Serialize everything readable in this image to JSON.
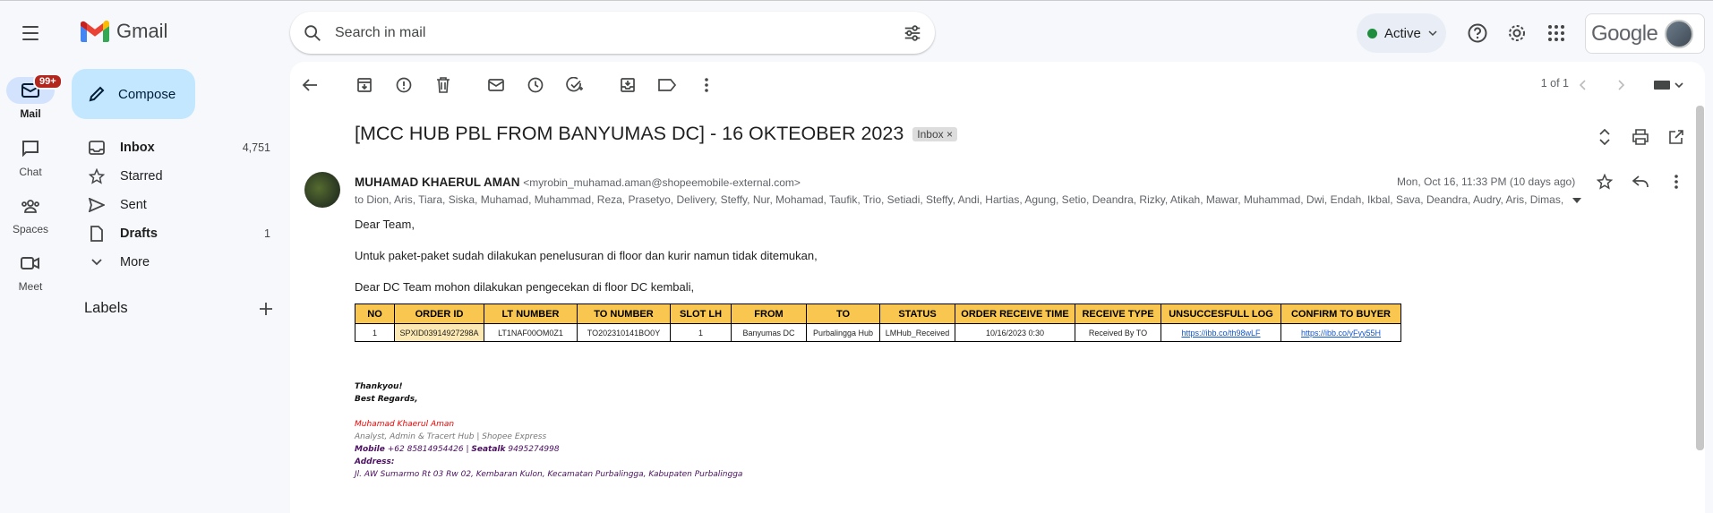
{
  "app": {
    "name": "Gmail"
  },
  "search": {
    "placeholder": "Search in mail"
  },
  "header": {
    "status": "Active",
    "account_brand": "Google"
  },
  "rail": {
    "mail_label": "Mail",
    "mail_badge": "99+",
    "chat_label": "Chat",
    "spaces_label": "Spaces",
    "meet_label": "Meet"
  },
  "nav": {
    "compose": "Compose",
    "items": [
      {
        "label": "Inbox",
        "count": "4,751",
        "icon": "inbox-icon"
      },
      {
        "label": "Starred",
        "count": "",
        "icon": "star-icon"
      },
      {
        "label": "Sent",
        "count": "",
        "icon": "send-icon"
      },
      {
        "label": "Drafts",
        "count": "1",
        "icon": "draft-icon"
      },
      {
        "label": "More",
        "count": "",
        "icon": "chevron-down-icon"
      }
    ],
    "labels_title": "Labels"
  },
  "toolbar": {
    "pager": "1 of 1"
  },
  "email": {
    "subject": "[MCC HUB PBL FROM BANYUMAS DC] - 16 OKTEOBER 2023",
    "tag": "Inbox",
    "sender_name": "MUHAMAD KHAERUL AMAN",
    "sender_email": "<myrobin_muhamad.aman@shopeemobile-external.com>",
    "to": "to Dion, Aris, Tiara, Siska, Muhamad, Muhammad, Reza, Prasetyo, Delivery, Steffy, Nur, Mohamad, Taufik, Trio, Setiadi, Steffy, Andi, Hartias, Agung, Setio, Deandra, Rizky, Atikah, Mawar, Muhammad, Dwi, Endah, Ikbal, Sava, Deandra, Audry, Aris, Dimas,",
    "date": "Mon, Oct 16, 11:33 PM (10 days ago)",
    "greeting": "Dear Team,",
    "line1": "Untuk paket-paket sudah dilakukan penelusuran di floor dan kurir namun tidak ditemukan,",
    "line2": "Dear DC Team mohon dilakukan pengecekan di floor DC kembali,",
    "table": {
      "headers": [
        "NO",
        "ORDER ID",
        "LT NUMBER",
        "TO NUMBER",
        "SLOT LH",
        "FROM",
        "TO",
        "STATUS",
        "ORDER RECEIVE TIME",
        "RECEIVE TYPE",
        "UNSUCCESFULL LOG",
        "CONFIRM TO BUYER"
      ],
      "rows": [
        [
          "1",
          "SPXID03914927298A",
          "LT1NAF00OM0Z1",
          "TO202310141BO0Y",
          "1",
          "Banyumas DC",
          "Purbalingga Hub",
          "LMHub_Received",
          "10/16/2023 0:30",
          "Received By TO",
          "https://ibb.co/th98wLF",
          "https://ibb.co/yFyy55H"
        ]
      ]
    },
    "signature": {
      "thanks": "Thankyou!",
      "regards": "Best Regards,",
      "name": "Muhamad Khaerul Aman",
      "role": "Analyst, Admin & Tracert Hub | Shopee Express",
      "mobile_label": "Mobile",
      "mobile": "+62 85814954426",
      "seatalk_label": "Seatalk",
      "seatalk": "9495274998",
      "address_label": "Address:",
      "address": "Jl. AW Sumarmo Rt 03 Rw 02, Kembaran Kulon, Kecamatan Purbalingga, Kabupaten Purbalingga"
    }
  },
  "colors": {
    "compose_bg": "#c2e7ff",
    "table_header": "#f9c74f",
    "badge": "#b3261e",
    "status_dot": "#1e8e3e"
  }
}
